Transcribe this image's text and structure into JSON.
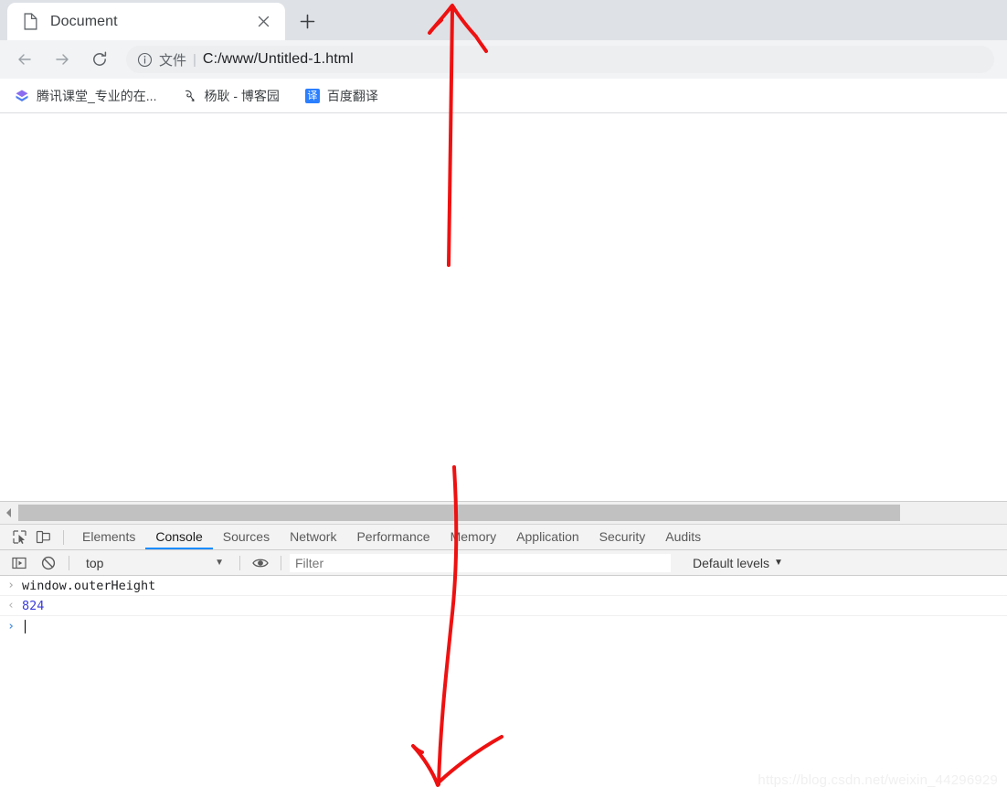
{
  "browser": {
    "tab": {
      "title": "Document",
      "favicon_icon": "document-page-icon",
      "close_icon": "close-icon"
    },
    "new_tab_label": "+",
    "nav": {
      "back_icon": "arrow-left-icon",
      "forward_icon": "arrow-right-icon",
      "reload_icon": "reload-icon"
    },
    "omnibox": {
      "info_icon": "info-circle-icon",
      "scheme_label": "文件",
      "separator": "|",
      "url": "C:/www/Untitled-1.html"
    },
    "bookmarks": [
      {
        "label": "腾讯课堂_专业的在...",
        "icon": "tencent-classroom-icon"
      },
      {
        "label": "杨耿 - 博客园",
        "icon": "cnblogs-icon"
      },
      {
        "label": "百度翻译",
        "icon": "baidu-fanyi-icon",
        "icon_text": "译"
      }
    ]
  },
  "devtools": {
    "scrollbar": {
      "left_arrow_icon": "scroll-left-arrow-icon"
    },
    "toolbar_icons": [
      {
        "name": "inspect-element-icon"
      },
      {
        "name": "device-toolbar-icon"
      }
    ],
    "tabs": [
      {
        "label": "Elements",
        "active": false
      },
      {
        "label": "Console",
        "active": true
      },
      {
        "label": "Sources",
        "active": false
      },
      {
        "label": "Network",
        "active": false
      },
      {
        "label": "Performance",
        "active": false
      },
      {
        "label": "Memory",
        "active": false
      },
      {
        "label": "Application",
        "active": false
      },
      {
        "label": "Security",
        "active": false
      },
      {
        "label": "Audits",
        "active": false
      }
    ],
    "console_toolbar": {
      "sidebar_toggle_icon": "console-sidebar-toggle-icon",
      "clear_icon": "clear-console-icon",
      "context_value": "top",
      "context_caret": "▼",
      "eye_icon": "live-expression-eye-icon",
      "filter_value": "",
      "filter_placeholder": "Filter",
      "levels_label": "Default levels",
      "levels_caret": "▼"
    },
    "console_log": [
      {
        "gutter": "›",
        "type": "input",
        "text": "window.outerHeight"
      },
      {
        "gutter": "‹",
        "type": "output",
        "text": "824"
      },
      {
        "gutter": "›",
        "type": "prompt",
        "text": ""
      }
    ]
  },
  "annotations": {
    "arrow_up_name": "red-arrow-up-annotation",
    "arrow_down_name": "red-arrow-down-annotation",
    "color": "#ee1111"
  },
  "watermark": {
    "text": "https://blog.csdn.net/weixin_44296929"
  }
}
